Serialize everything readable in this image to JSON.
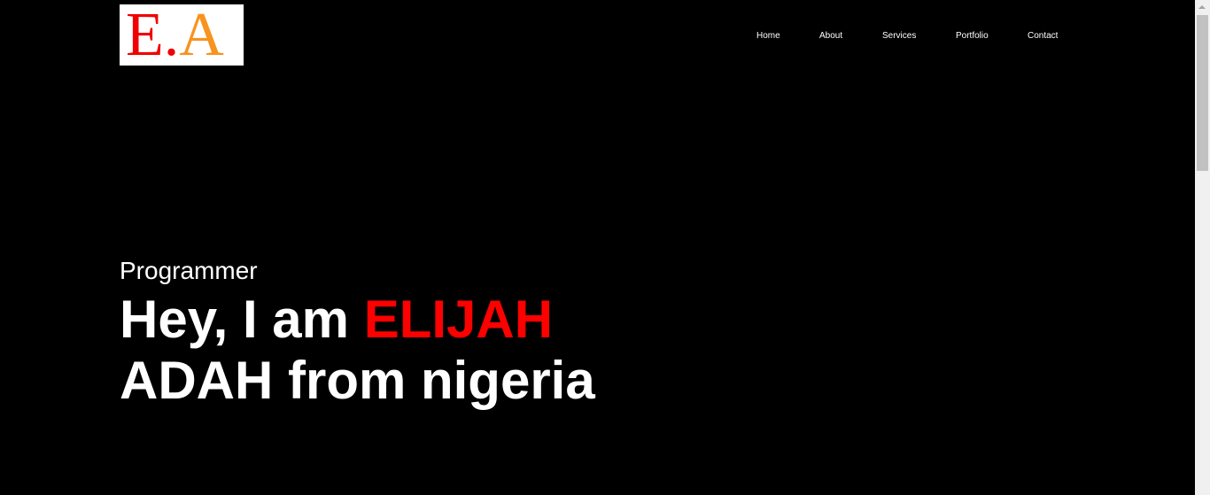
{
  "logo": {
    "letter_e": "E",
    "dot": ".",
    "letter_a": "A",
    "colors": {
      "e": "#f00000",
      "a": "#f7931e",
      "background": "#ffffff"
    }
  },
  "nav": {
    "items": [
      {
        "label": "Home"
      },
      {
        "label": "About"
      },
      {
        "label": "Services"
      },
      {
        "label": "Portfolio"
      },
      {
        "label": "Contact"
      }
    ]
  },
  "hero": {
    "subtitle": "Programmer",
    "greeting": "Hey, I am ",
    "name_highlight": "ELIJAH",
    "name_rest": "ADAH from nigeria"
  },
  "colors": {
    "background": "#000000",
    "text": "#ffffff",
    "accent": "#ff0000"
  }
}
